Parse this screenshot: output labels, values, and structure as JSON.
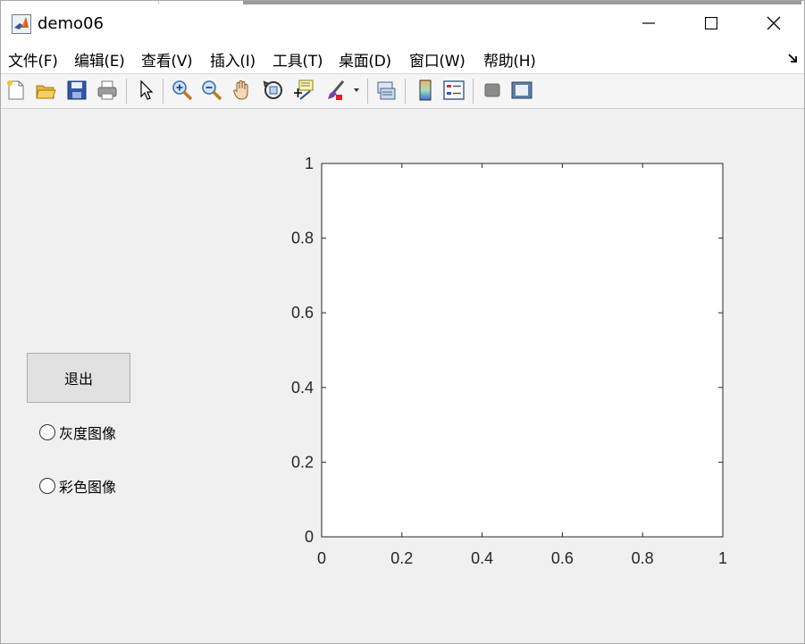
{
  "window": {
    "title": "demo06",
    "controls": {
      "minimize": "minimize",
      "maximize": "maximize",
      "close": "close"
    }
  },
  "menu": {
    "items": [
      {
        "label": "文件(F)"
      },
      {
        "label": "编辑(E)"
      },
      {
        "label": "查看(V)"
      },
      {
        "label": "插入(I)"
      },
      {
        "label": "工具(T)"
      },
      {
        "label": "桌面(D)"
      },
      {
        "label": "窗口(W)"
      },
      {
        "label": "帮助(H)"
      }
    ]
  },
  "toolbar": {
    "buttons": [
      "new-figure-icon",
      "open-file-icon",
      "save-icon",
      "print-icon",
      "select-arrow-icon",
      "zoom-in-icon",
      "zoom-out-icon",
      "pan-hand-icon",
      "rotate-3d-icon",
      "data-cursor-icon",
      "brush-icon",
      "brush-dropdown-icon",
      "link-plot-icon",
      "colorbar-icon",
      "legend-icon",
      "hide-plot-tools-icon",
      "show-plot-tools-icon"
    ]
  },
  "controls": {
    "exit_label": "退出",
    "radio_gray_label": "灰度图像",
    "radio_color_label": "彩色图像"
  },
  "chart_data": {
    "type": "line",
    "title": "",
    "xlabel": "",
    "ylabel": "",
    "xlim": [
      0,
      1
    ],
    "ylim": [
      0,
      1
    ],
    "xticks": [
      "0",
      "0.2",
      "0.4",
      "0.6",
      "0.8",
      "1"
    ],
    "yticks": [
      "0",
      "0.2",
      "0.4",
      "0.6",
      "0.8",
      "1"
    ],
    "grid": false,
    "series": []
  },
  "colors": {
    "background": "#f0f0f0",
    "button_face": "#e1e1e1",
    "axes_face": "#ffffff",
    "axes_edge": "#262626"
  }
}
